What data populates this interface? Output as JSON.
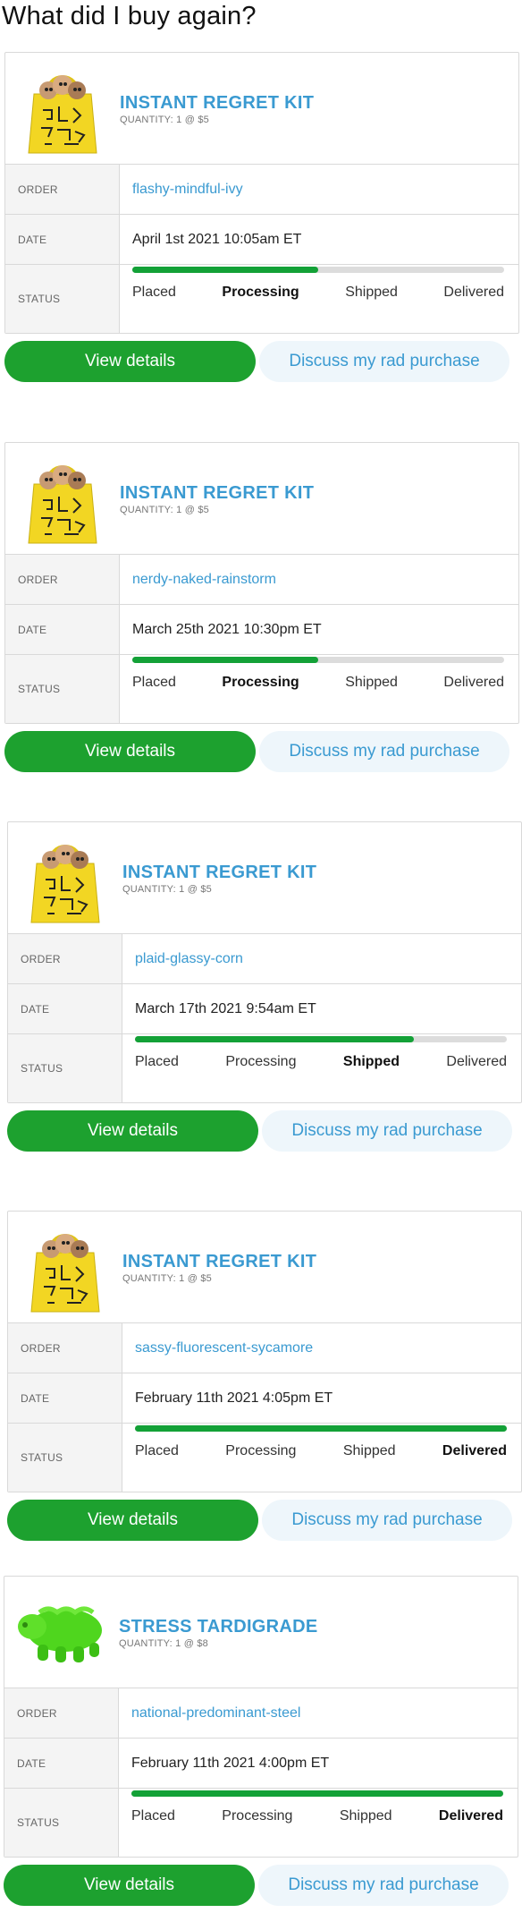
{
  "page": {
    "title": "What did I buy again?"
  },
  "labels": {
    "order": "ORDER",
    "date": "DATE",
    "status": "STATUS"
  },
  "steps": [
    "Placed",
    "Processing",
    "Shipped",
    "Delivered"
  ],
  "buttons": {
    "details": "View details",
    "discuss": "Discuss my rad purchase"
  },
  "colors": {
    "accent": "#3a9ad1",
    "green": "#1da12f",
    "progress": "#13a137",
    "track": "#dcdcdc"
  },
  "orders": [
    {
      "product": "INSTANT REGRET KIT",
      "quantity": "QUANTITY: 1 @ $5",
      "image": "yellow-tote-bag",
      "order_id": "flashy-mindful-ivy",
      "date": "April 1st 2021 10:05am ET",
      "status": "Processing",
      "progress": 0.5
    },
    {
      "product": "INSTANT REGRET KIT",
      "quantity": "QUANTITY: 1 @ $5",
      "image": "yellow-tote-bag",
      "order_id": "nerdy-naked-rainstorm",
      "date": "March 25th 2021 10:30pm ET",
      "status": "Processing",
      "progress": 0.5
    },
    {
      "product": "INSTANT REGRET KIT",
      "quantity": "QUANTITY: 1 @ $5",
      "image": "yellow-tote-bag",
      "order_id": "plaid-glassy-corn",
      "date": "March 17th 2021 9:54am ET",
      "status": "Shipped",
      "progress": 0.75
    },
    {
      "product": "INSTANT REGRET KIT",
      "quantity": "QUANTITY: 1 @ $5",
      "image": "yellow-tote-bag",
      "order_id": "sassy-fluorescent-sycamore",
      "date": "February 11th 2021 4:05pm ET",
      "status": "Delivered",
      "progress": 1.0
    },
    {
      "product": "STRESS TARDIGRADE",
      "quantity": "QUANTITY: 1 @ $8",
      "image": "green-tardigrade",
      "order_id": "national-predominant-steel",
      "date": "February 11th 2021 4:00pm ET",
      "status": "Delivered",
      "progress": 1.0
    }
  ]
}
